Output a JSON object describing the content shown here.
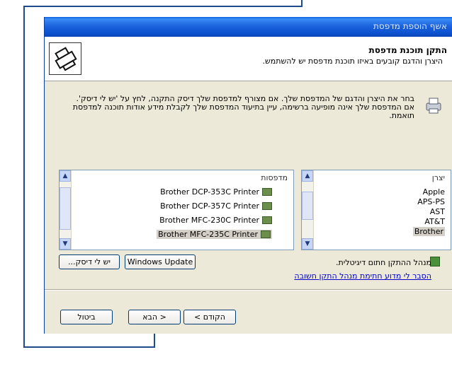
{
  "window": {
    "title": "אשף הוספת מדפסת"
  },
  "header": {
    "title": "התקן תוכנת מדפסת",
    "subtitle": "היצרן והדגם קובעים באיזו תוכנת מדפסת יש להשתמש."
  },
  "instructions": "בחר את היצרן והדגם של המדפסת שלך. אם מצורף למדפסת שלך דיסק התקנה, לחץ על 'יש לי דיסק'. אם המדפסת שלך אינה מופיעה ברשימה, עיין בתיעוד המדפסת שלך לקבלת מידע אודות תוכנה למדפסת תואמת.",
  "printers": {
    "header": "מדפסות",
    "items": [
      "Brother DCP-353C Printer",
      "Brother DCP-357C Printer",
      "Brother MFC-230C Printer",
      "Brother MFC-235C Printer"
    ],
    "selected_index": 3
  },
  "manufacturers": {
    "header": "יצרן",
    "items": [
      "Apple",
      "APS-PS",
      "AST",
      "AT&T",
      "Brother"
    ],
    "selected_index": 4
  },
  "buttons": {
    "windows_update": "Windows Update",
    "have_disk": "...יש לי דיסק",
    "back": "< הקודם",
    "next": "הבא >",
    "cancel": "ביטול"
  },
  "signed_notice": "מנהל ההתקן חתום דיגיטלית.",
  "signing_link": "הסבר לי מדוע חתימת מנהל התקן חשובה"
}
